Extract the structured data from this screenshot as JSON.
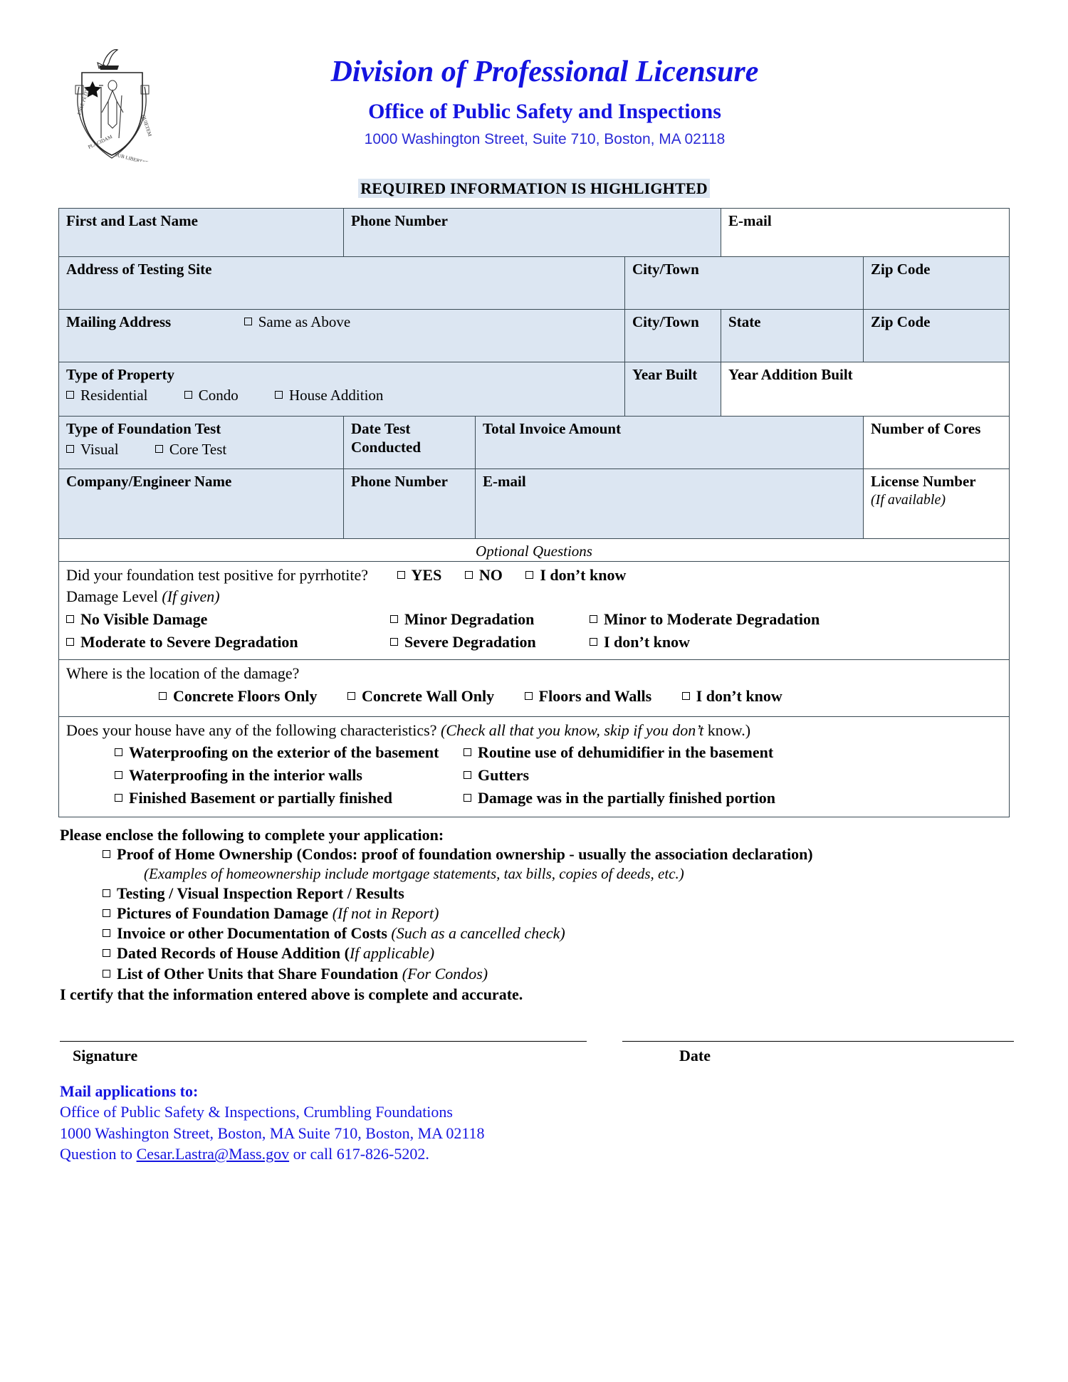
{
  "header": {
    "org_title": "Division of Professional Licensure",
    "office_title": "Office of Public Safety and Inspections",
    "address": "1000 Washington Street, Suite 710, Boston, MA 02118",
    "seal_icon": "massachusetts-state-seal-icon",
    "required_banner": "REQUIRED INFORMATION IS HIGHLIGHTED"
  },
  "colors": {
    "brand_blue": "#1414e0",
    "highlight": "#dce6f2",
    "border": "#3a4a54"
  },
  "form": {
    "row1": {
      "name_label": "First and Last Name",
      "phone_label": "Phone Number",
      "email_label": "E-mail"
    },
    "row2": {
      "address_label": "Address of Testing Site",
      "city_label": "City/Town",
      "zip_label": "Zip Code"
    },
    "row3": {
      "mailing_label": "Mailing Address",
      "same_as_above": "Same as Above",
      "city_label": "City/Town",
      "state_label": "State",
      "zip_label": "Zip Code"
    },
    "row4": {
      "property_label": "Type of Property",
      "options": [
        "Residential",
        "Condo",
        "House Addition"
      ],
      "year_built_label": "Year Built",
      "year_addition_label": "Year Addition Built"
    },
    "row5": {
      "test_type_label": "Type of Foundation Test",
      "options": [
        "Visual",
        "Core Test"
      ],
      "date_label_line1": "Date Test",
      "date_label_line2": "Conducted",
      "invoice_label": "Total Invoice Amount",
      "cores_label": "Number of Cores"
    },
    "row6": {
      "company_label": "Company/Engineer Name",
      "phone_label": "Phone Number",
      "email_label": "E-mail",
      "license_label": "License Number",
      "license_note": "(If available)"
    }
  },
  "optional": {
    "heading": "Optional Questions",
    "q1": {
      "text": "Did your foundation test positive for pyrrhotite?",
      "choices": [
        "YES",
        "NO",
        "I don’t know"
      ]
    },
    "damage": {
      "label": "Damage Level ",
      "label_italic": "(If given)",
      "row1": [
        "No Visible Damage",
        "Minor Degradation",
        "Minor to Moderate Degradation"
      ],
      "row2": [
        "Moderate to Severe Degradation",
        "Severe Degradation",
        "I don’t know"
      ]
    },
    "q2": {
      "text": "Where is the location of the damage?",
      "choices": [
        "Concrete Floors Only",
        "Concrete Wall Only",
        "Floors and Walls",
        "I don’t know"
      ]
    },
    "q3": {
      "text": "Does your house have any of the following characteristics? ",
      "text_italic": "(Check all that you know, skip if you don’t",
      "text_tail": " know.)",
      "left": [
        "Waterproofing on the exterior of the basement",
        "Waterproofing in the interior walls",
        "Finished Basement or partially finished"
      ],
      "right": [
        "Routine use of dehumidifier in the basement",
        "Gutters",
        "Damage was in the partially finished portion"
      ]
    }
  },
  "enclose": {
    "title": "Please enclose the following to complete your application:",
    "items": [
      {
        "bold": "Proof of Home Ownership (Condos: proof of foundation ownership - usually the association declaration)",
        "italic": "",
        "note": "(Examples of homeownership include mortgage statements, tax bills, copies of deeds, etc.)"
      },
      {
        "bold": "Testing / Visual Inspection Report / Results",
        "italic": "",
        "note": ""
      },
      {
        "bold": "Pictures of Foundation Damage ",
        "italic": "(If not in Report)",
        "note": ""
      },
      {
        "bold": "Invoice or other Documentation of Costs ",
        "italic": "(Such as a cancelled check)",
        "note": ""
      },
      {
        "bold": "Dated Records of House Addition (",
        "italic": "If applicable)",
        "note": ""
      },
      {
        "bold": "List of Other Units that Share Foundation ",
        "italic": "(For Condos)",
        "note": ""
      }
    ],
    "certify": "I certify that the information entered above is complete and accurate."
  },
  "signature": {
    "signature_label": "Signature",
    "date_label": "Date"
  },
  "footer": {
    "mail_to": "Mail applications to:",
    "line1": "Office of Public Safety & Inspections, Crumbling Foundations",
    "line2": "1000 Washington Street, Boston, MA Suite 710, Boston, MA 02118",
    "line3_pre": "Question to ",
    "line3_email": "Cesar.Lastra@Mass.gov",
    "line3_post": " or call 617-826-5202."
  }
}
